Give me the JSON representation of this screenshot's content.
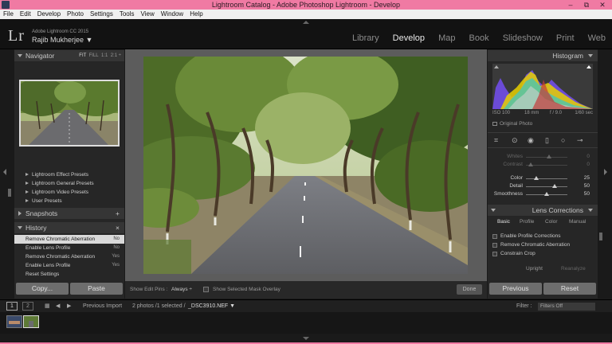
{
  "window": {
    "title": "Lightroom Catalog - Adobe Photoshop Lightroom - Develop",
    "controls": [
      "–",
      "⧉",
      "✕"
    ]
  },
  "menu": [
    "File",
    "Edit",
    "Develop",
    "Photo",
    "Settings",
    "Tools",
    "View",
    "Window",
    "Help"
  ],
  "identity": {
    "logo": "Lr",
    "product": "Adobe Lightroom CC 2015",
    "user": "Rajib Mukherjee ▼"
  },
  "modules": [
    "Library",
    "Develop",
    "Map",
    "Book",
    "Slideshow",
    "Print",
    "Web"
  ],
  "active_module": "Develop",
  "left_panel": {
    "navigator": {
      "title": "Navigator",
      "zooms": [
        "FIT",
        "FILL",
        "1:1",
        "2:1 ÷"
      ]
    },
    "presets": [
      "Lightroom Effect Presets",
      "Lightroom General Presets",
      "Lightroom Video Presets",
      "User Presets"
    ],
    "snapshots": {
      "title": "Snapshots",
      "action": "+"
    },
    "history": {
      "title": "History",
      "action": "×",
      "items": [
        {
          "label": "Remove Chromatic Aberration",
          "value": "No"
        },
        {
          "label": "Enable Lens Profile",
          "value": "No"
        },
        {
          "label": "Remove Chromatic Aberration",
          "value": "Yes"
        },
        {
          "label": "Enable Lens Profile",
          "value": "Yes"
        },
        {
          "label": "Reset Settings",
          "value": ""
        }
      ]
    },
    "copy_button": "Copy...",
    "paste_button": "Paste"
  },
  "toolbar": {
    "show_edit_pins_label": "Show Edit Pins :",
    "show_edit_pins_value": "Always ÷",
    "mask_overlay_label": "Show Selected Mask Overlay",
    "done_button": "Done"
  },
  "right_panel": {
    "histogram": {
      "title": "Histogram",
      "iso": "ISO 100",
      "focal": "18 mm",
      "aperture": "f / 9.0",
      "shutter": "1/60 sec",
      "original_photo": "Original Photo"
    },
    "sliders_dim": [
      {
        "label": "Whites",
        "value": "0"
      },
      {
        "label": "Contrast",
        "value": "0"
      }
    ],
    "sliders": [
      {
        "label": "Color",
        "value": "25",
        "pos": 0.25
      },
      {
        "label": "Detail",
        "value": "50",
        "pos": 0.7
      },
      {
        "label": "Smoothness",
        "value": "50",
        "pos": 0.5
      }
    ],
    "lens_corrections": {
      "title": "Lens Corrections",
      "tabs": [
        "Basic",
        "Profile",
        "Color",
        "Manual"
      ],
      "active_tab": "Basic",
      "options": [
        "Enable Profile Corrections",
        "Remove Chromatic Aberration",
        "Constrain Crop"
      ],
      "upright": "Upright",
      "reanalyze": "Reanalyze"
    },
    "previous_button": "Previous",
    "reset_button": "Reset"
  },
  "filmstrip": {
    "pages": [
      "1",
      "2"
    ],
    "previous_import": "Previous Import",
    "info_count": "2 photos /1 selected /",
    "info_file": "_DSC3910.NEF ▼",
    "filter_label": "Filter :",
    "filter_value": "Filters Off"
  },
  "colors": {
    "title_bar": "#f07aa3",
    "panel_bg": "#262626",
    "panel_header": "#353535",
    "selected_row": "#d9d9d9"
  }
}
